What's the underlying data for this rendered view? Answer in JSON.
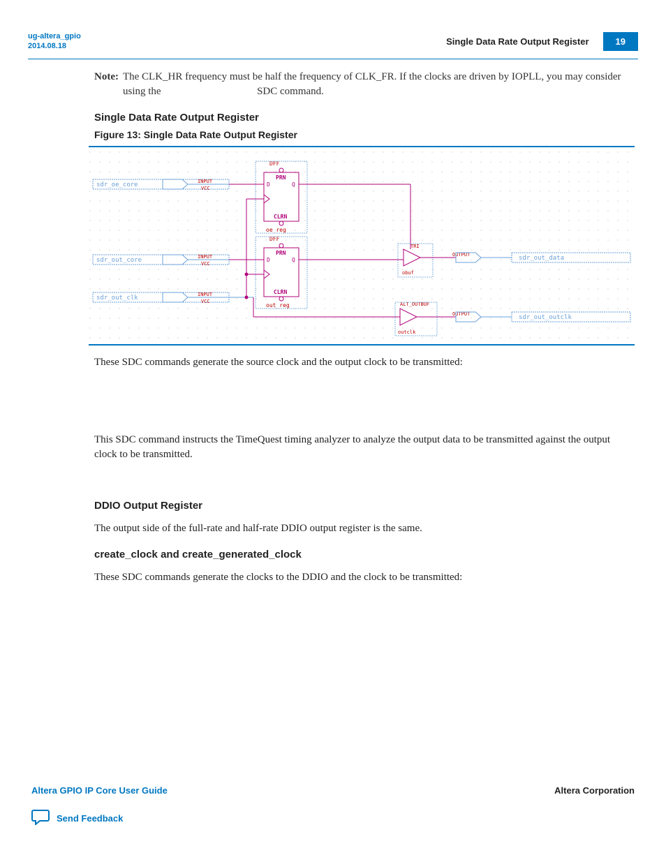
{
  "header": {
    "doc_id_line1": "ug-altera_gpio",
    "doc_id_line2": "2014.08.18",
    "section_title": "Single Data Rate Output Register",
    "page_number": "19"
  },
  "note": {
    "label": "Note:",
    "text": "The CLK_HR frequency must be half the frequency of CLK_FR. If the clocks are driven by IOPLL, you may consider using the",
    "text_suffix": "SDC command."
  },
  "sections": {
    "h1": "Single Data Rate Output Register",
    "figure_title": "Figure 13: Single Data Rate Output Register",
    "para1": "These SDC commands generate the source clock and the output clock to be transmitted:",
    "para2": "This SDC command instructs the TimeQuest timing analyzer to analyze the output data to be transmitted against the output clock to be transmitted.",
    "h2": "DDIO Output Register",
    "para3": "The output side of the full-rate and half-rate DDIO output register is the same.",
    "h3": "create_clock and create_generated_clock",
    "para4": "These SDC commands generate the clocks to the DDIO and the clock to be transmitted:"
  },
  "diagram": {
    "inputs": {
      "sdr_oe_core": "sdr_oe_core",
      "sdr_out_core": "sdr_out_core",
      "sdr_out_clk": "sdr_out_clk"
    },
    "input_label": "INPUT",
    "vcc_label": "VCC",
    "dff_label": "DFF",
    "prn_label": "PRN",
    "d_label": "D",
    "q_label": "Q",
    "clrn_label": "CLRN",
    "reg1_name": "oe_reg",
    "reg2_name": "out_reg",
    "tri_label": "TRI",
    "obuf_label": "obuf",
    "alt_outbuf_label": "ALT_OUTBUF",
    "outclk_label": "outclk",
    "output_label": "OUTPUT",
    "outputs": {
      "sdr_out_data": "sdr_out_data",
      "sdr_out_outclk": "sdr_out_outclk"
    }
  },
  "footer": {
    "left": "Altera GPIO IP Core User Guide",
    "right": "Altera Corporation",
    "feedback": "Send Feedback"
  }
}
